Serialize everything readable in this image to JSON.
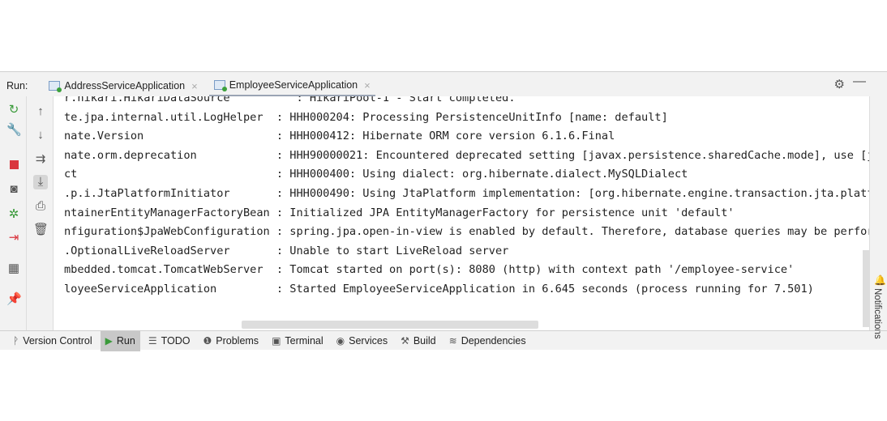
{
  "run_label": "Run:",
  "tabs": [
    {
      "label": "AddressServiceApplication",
      "active": false
    },
    {
      "label": "EmployeeServiceApplication",
      "active": true
    }
  ],
  "close_glyph": "×",
  "left_toolbar_1": [
    "rerun-icon",
    "wrench-icon",
    "stop-icon",
    "camera-icon",
    "debug-icon",
    "exit-icon",
    "layout-icon",
    "pin-icon"
  ],
  "left_toolbar_2": [
    "arrow-up-icon",
    "arrow-down-icon",
    "soft-wrap-icon",
    "scroll-to-end-icon",
    "print-icon",
    "trash-icon"
  ],
  "console_lines": [
    "r.hikari.HikariDataSource          : HikariPool-1 - Start completed.",
    "te.jpa.internal.util.LogHelper  : HHH000204: Processing PersistenceUnitInfo [name: default]",
    "nate.Version                    : HHH000412: Hibernate ORM core version 6.1.6.Final",
    "nate.orm.deprecation            : HHH90000021: Encountered deprecated setting [javax.persistence.sharedCache.mode], use [j",
    "ct                              : HHH000400: Using dialect: org.hibernate.dialect.MySQLDialect",
    ".p.i.JtaPlatformInitiator       : HHH000490: Using JtaPlatform implementation: [org.hibernate.engine.transaction.jta.platf",
    "ntainerEntityManagerFactoryBean : Initialized JPA EntityManagerFactory for persistence unit 'default'",
    "nfiguration$JpaWebConfiguration : spring.jpa.open-in-view is enabled by default. Therefore, database queries may be perfor",
    ".OptionalLiveReloadServer       : Unable to start LiveReload server",
    "mbedded.tomcat.TomcatWebServer  : Tomcat started on port(s): 8080 (http) with context path '/employee-service'",
    "loyeeServiceApplication         : Started EmployeeServiceApplication in 6.645 seconds (process running for 7.501)"
  ],
  "notifications_label": "Notifications",
  "bottom_tools": [
    {
      "label": "Version Control",
      "icon": "branch-icon",
      "glyph": "ᚹ"
    },
    {
      "label": "Run",
      "icon": "run-icon",
      "glyph": "▶",
      "active": true
    },
    {
      "label": "TODO",
      "icon": "list-icon",
      "glyph": "☰"
    },
    {
      "label": "Problems",
      "icon": "problems-icon",
      "glyph": "❶"
    },
    {
      "label": "Terminal",
      "icon": "terminal-icon",
      "glyph": "▣"
    },
    {
      "label": "Services",
      "icon": "services-icon",
      "glyph": "◉"
    },
    {
      "label": "Build",
      "icon": "build-icon",
      "glyph": "⚒"
    },
    {
      "label": "Dependencies",
      "icon": "dependencies-icon",
      "glyph": "≋"
    }
  ]
}
